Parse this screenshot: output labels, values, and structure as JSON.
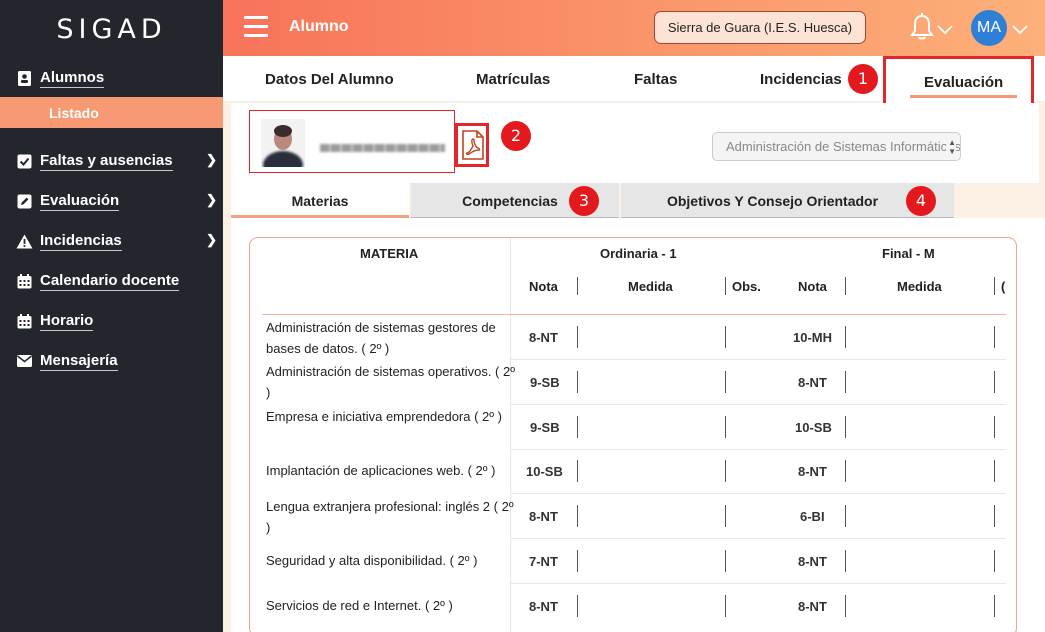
{
  "app": {
    "brand": "SIGAD"
  },
  "sidebar": {
    "items": [
      {
        "label": "Alumnos",
        "icon": "student-icon"
      },
      {
        "label": "Faltas y ausencias",
        "icon": "check-icon"
      },
      {
        "label": "Evaluación",
        "icon": "edit-icon"
      },
      {
        "label": "Incidencias",
        "icon": "warning-icon"
      },
      {
        "label": "Calendario docente",
        "icon": "calendar-icon"
      },
      {
        "label": "Horario",
        "icon": "calendar-icon"
      },
      {
        "label": "Mensajería",
        "icon": "envelope-icon"
      }
    ],
    "subitem": "Listado"
  },
  "header": {
    "title": "Alumno",
    "center": "Sierra de Guara (I.E.S. Huesca)",
    "avatar": "MA"
  },
  "tabs": [
    "Datos Del Alumno",
    "Matrículas",
    "Faltas",
    "Incidencias",
    "Evaluación"
  ],
  "badges": [
    "1",
    "2",
    "3",
    "4"
  ],
  "student": {
    "course_select": "Administración de Sistemas Informáticos"
  },
  "subtabs": [
    "Materias",
    "Competencias",
    "Objetivos Y Consejo Orientador"
  ],
  "table": {
    "materia_header": "MATERIA",
    "group1": "Ordinaria - 1",
    "group2": "Final - M",
    "cols": [
      "Nota",
      "Medida",
      "Obs.",
      "Nota",
      "Medida",
      "("
    ],
    "rows": [
      {
        "materia": "Administración de sistemas gestores de bases de datos.  ( 2º )",
        "ord": "8-NT",
        "fin": "10-MH"
      },
      {
        "materia": "Administración de sistemas operativos.  ( 2º )",
        "ord": "9-SB",
        "fin": "8-NT"
      },
      {
        "materia": "Empresa e iniciativa emprendedora  ( 2º )",
        "ord": "9-SB",
        "fin": "10-SB"
      },
      {
        "materia": "Implantación de aplicaciones web.  ( 2º )",
        "ord": "10-SB",
        "fin": "8-NT"
      },
      {
        "materia": "Lengua extranjera profesional: inglés 2  ( 2º )",
        "ord": "8-NT",
        "fin": "6-BI"
      },
      {
        "materia": "Seguridad y alta disponibilidad.  ( 2º )",
        "ord": "7-NT",
        "fin": "8-NT"
      },
      {
        "materia": "Servicios de red e Internet.  ( 2º )",
        "ord": "8-NT",
        "fin": "8-NT"
      }
    ]
  }
}
